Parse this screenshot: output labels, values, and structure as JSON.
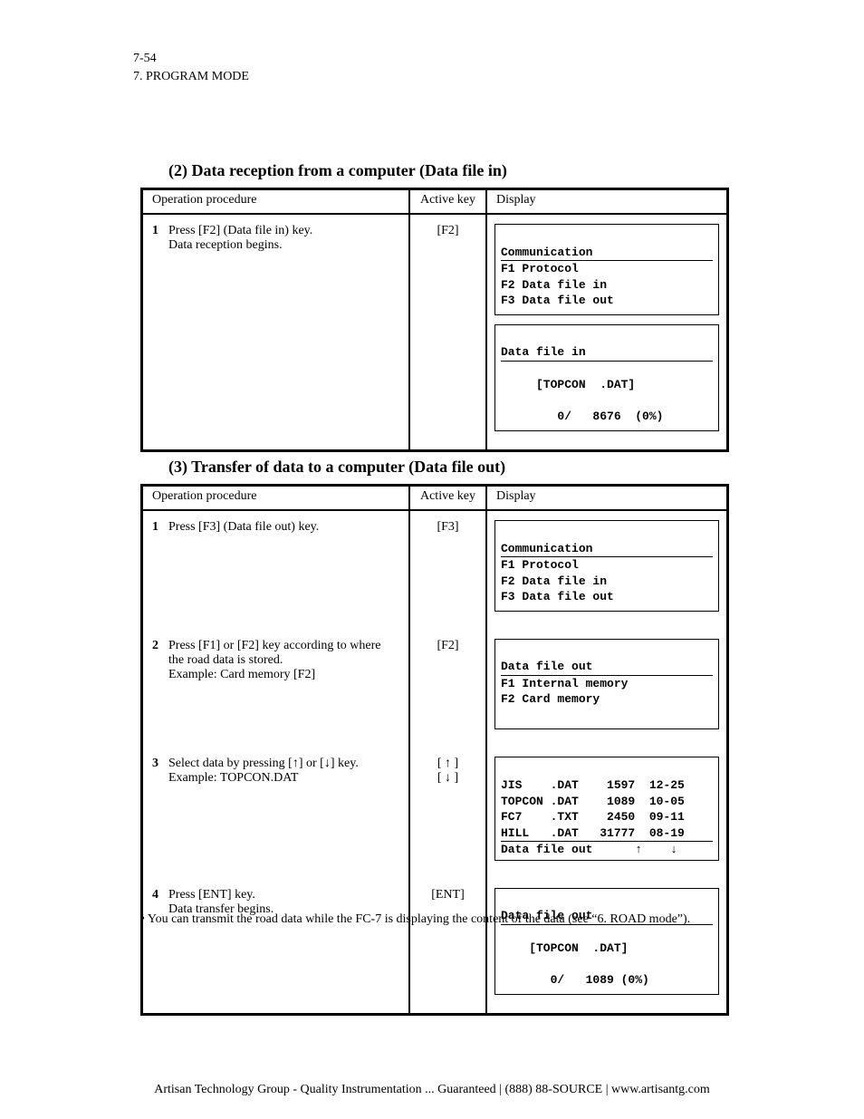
{
  "header": {
    "page_label": "7-54",
    "section": "7. PROGRAM MODE"
  },
  "section1": {
    "num": "(2) ",
    "title": "Data reception from a computer (Data file in)",
    "columns": {
      "op": "Operation procedure",
      "ak": "Active key",
      "dp": "Display"
    },
    "step1_no": "1",
    "step1_txt": "Press [F2] (Data file in) key.",
    "step1_txt2": "Data reception begins.",
    "key1": "[F2]",
    "screen1": {
      "title": "Communication",
      "l1": "F1 Protocol",
      "l2": "F2 Data file in",
      "l3": "F3 Data file out"
    },
    "screen2": {
      "title": "Data file in",
      "l1": "     [TOPCON  .DAT]",
      "l2": "        0/   8676  (0%)"
    }
  },
  "section2": {
    "num": "(3) ",
    "title": "Transfer of data to a computer (Data file out)",
    "columns": {
      "op": "Operation procedure",
      "ak": "Active key",
      "dp": "Display"
    },
    "step1_no": "1",
    "step1_txt": "Press [F3] (Data file out) key.",
    "key1": "[F3]",
    "step2_no": "2",
    "step2_txt": "Press [F1] or [F2] key according to where the road data is stored.",
    "step2_ex": "Example: Card memory [F2]",
    "key2": "[F2]",
    "step3_no": "3",
    "step3_txt_a": "Select data by pressing [",
    "step3_txt_b": "] or [",
    "step3_txt_c": "] key.",
    "step3_ex": "Example: TOPCON.DAT",
    "key3": "[ ↑ ]\n[ ↓ ]",
    "step4_no": "4",
    "step4_txt": "Press [ENT] key.",
    "step4_txt2": "Data transfer begins.",
    "key4": "[ENT]",
    "screen1": {
      "title": "Communication",
      "l1": "F1 Protocol",
      "l2": "F2 Data file in",
      "l3": "F3 Data file out"
    },
    "screen2": {
      "title": "Data file out",
      "l1": "F1 Internal memory",
      "l2": "F2 Card memory"
    },
    "screen3": {
      "r1": "JIS    .DAT    1597  12-25",
      "r2": "TOPCON .DAT    1089  10-05",
      "r3": "FC7    .TXT    2450  09-11",
      "r4": "HILL   .DAT   31777  08-19",
      "foot": "Data file out      ↑    ↓"
    },
    "screen4": {
      "title": "Data file out",
      "l1": "    [TOPCON  .DAT]",
      "l2": "       0/   1089 (0%)"
    }
  },
  "note": "• You can transmit the road data while the FC-7 is displaying the content of the data (see “6. ROAD mode”).",
  "footer": "Artisan Technology Group - Quality Instrumentation ... Guaranteed | (888) 88-SOURCE | www.artisantg.com"
}
